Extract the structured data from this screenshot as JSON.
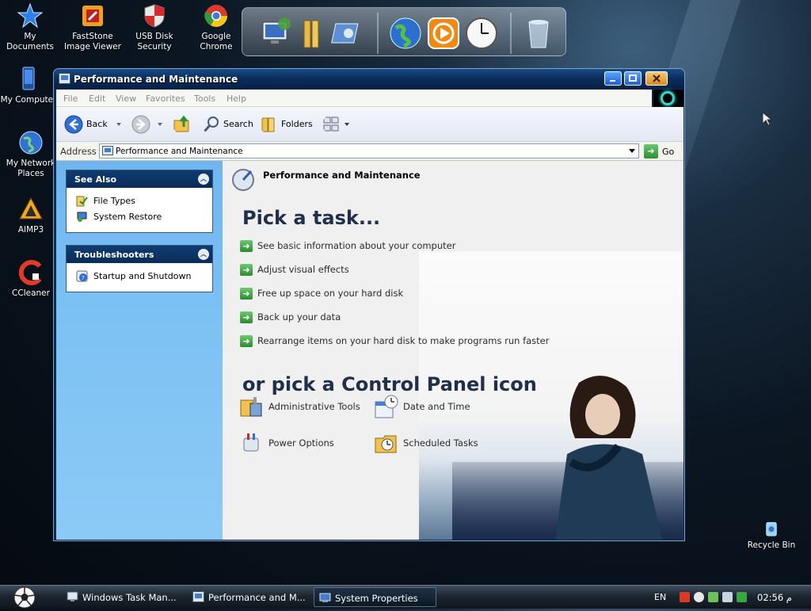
{
  "desktop": {
    "icons": [
      {
        "label": "My Documents"
      },
      {
        "label": "FastStone Image Viewer"
      },
      {
        "label": "USB Disk Security"
      },
      {
        "label": "Google Chrome"
      },
      {
        "label": "My Computer"
      },
      {
        "label": "My Network Places"
      },
      {
        "label": "AIMP3"
      },
      {
        "label": "CCleaner"
      },
      {
        "label": "Recycle Bin"
      }
    ]
  },
  "window": {
    "title": "Performance and Maintenance",
    "menu": [
      "File",
      "Edit",
      "View",
      "Favorites",
      "Tools",
      "Help"
    ],
    "toolbar": {
      "back_label": "Back",
      "search_label": "Search",
      "folders_label": "Folders"
    },
    "address": {
      "label": "Address",
      "value": "Performance and Maintenance",
      "go_label": "Go"
    },
    "sidebar": {
      "see_also": {
        "title": "See Also",
        "items": [
          "File Types",
          "System Restore"
        ]
      },
      "troubleshooters": {
        "title": "Troubleshooters",
        "items": [
          "Startup and Shutdown"
        ]
      }
    },
    "content": {
      "header": "Performance and Maintenance",
      "pick_task": "Pick a task...",
      "tasks": [
        "See basic information about your computer",
        "Adjust visual effects",
        "Free up space on your hard disk",
        "Back up your data",
        "Rearrange items on your hard disk to make programs run faster"
      ],
      "pick_icon": "or pick a Control Panel icon",
      "icons": [
        "Administrative Tools",
        "Date and Time",
        "Power Options",
        "Scheduled Tasks"
      ]
    }
  },
  "taskbar": {
    "buttons": [
      "Windows Task Man...",
      "Performance and M...",
      "System Properties"
    ],
    "language": "EN",
    "clock": "02:56 م"
  },
  "colors": {
    "title_bar": "#0a2c5b",
    "sidebar": "#7cc1f3",
    "task_arrow": "#2c8b30",
    "heading": "#21304a"
  }
}
